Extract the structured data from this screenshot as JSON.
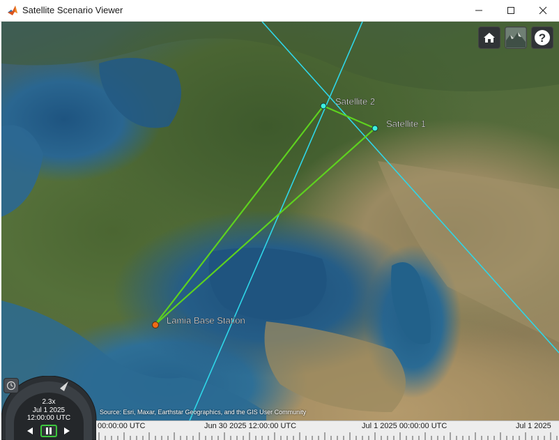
{
  "window": {
    "title": "Satellite Scenario Viewer"
  },
  "map": {
    "labels": {
      "satellite_1": "Satellite 1",
      "satellite_2": "Satellite 2",
      "ground_station": "Lamia Base Station"
    },
    "attribution": "Source: Esri, Maxar, Earthstar Geographics, and the GIS User Community",
    "colors": {
      "orbit": "#2fd6e8",
      "access_link": "#5ed11f",
      "satellite_marker": "#3ef0e0",
      "station_marker": "#f06b18"
    }
  },
  "toolbar": {
    "home_icon": "home-icon",
    "base_layer_icon": "base-layer-picker-icon",
    "help_icon": "question-mark-icon"
  },
  "animation": {
    "speed": "2.3x",
    "date": "Jul 1 2025",
    "time": "12:00:00 UTC",
    "clock_icon": "clock-icon",
    "rewind_icon": "play-reverse-icon",
    "pause_icon": "pause-icon",
    "forward_icon": "play-forward-icon"
  },
  "timeline": {
    "labels": [
      "00:00:00 UTC",
      "Jun 30 2025 12:00:00 UTC",
      "Jul 1 2025 00:00:00 UTC",
      "Jul 1 2025"
    ]
  }
}
